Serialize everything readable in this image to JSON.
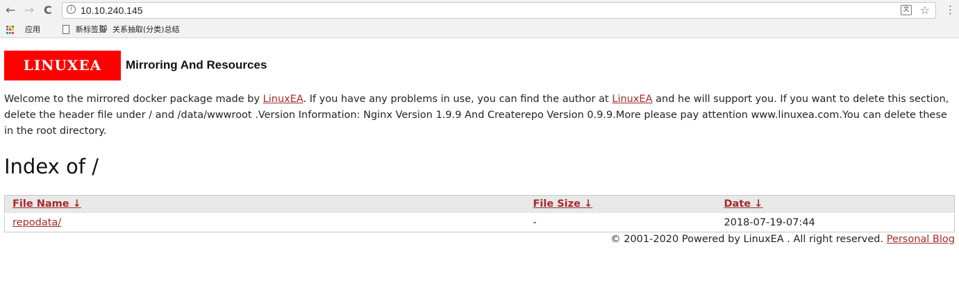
{
  "browser": {
    "url": "10.10.240.145",
    "back_icon": "←",
    "forward_icon": "→",
    "reload_icon": "C",
    "info_icon": "i",
    "translate_icon": "文",
    "star_icon": "☆",
    "menu_icon": "⋮",
    "bookmarks": [
      {
        "label": "应用"
      },
      {
        "label": "新标签页"
      },
      {
        "label": "关系抽取(分类)总结"
      }
    ]
  },
  "brand": {
    "logo_text": "LINUXEA",
    "logo_color": "#ff0000",
    "title": "Mirroring And Resources"
  },
  "intro": {
    "part1": "Welcome to the mirrored docker package made by ",
    "link1": "LinuxEA",
    "part2": ". If you have any problems in use, you can find the author at ",
    "link2": "LinuxEA",
    "part3": " and he will support you. If you want to delete this section, delete the header file under / and /data/wwwroot .Version Information: Nginx Version 1.9.9 And Createrepo Version 0.9.9.More please pay attention www.linuxea.com.You can delete these in the root directory."
  },
  "heading": "Index of /",
  "table": {
    "headers": [
      {
        "label": "File Name",
        "sort": "↓"
      },
      {
        "label": "File Size",
        "sort": "↓"
      },
      {
        "label": "Date",
        "sort": "↓"
      }
    ],
    "rows": [
      {
        "name": "repodata/",
        "size": "-",
        "date": "2018-07-19-07:44"
      }
    ]
  },
  "footer": {
    "text": "© 2001-2020 Powered by LinuxEA . All right reserved. ",
    "link": "Personal Blog"
  },
  "colors": {
    "link": "#a52a2a",
    "header_bg": "#e8e8e8"
  }
}
